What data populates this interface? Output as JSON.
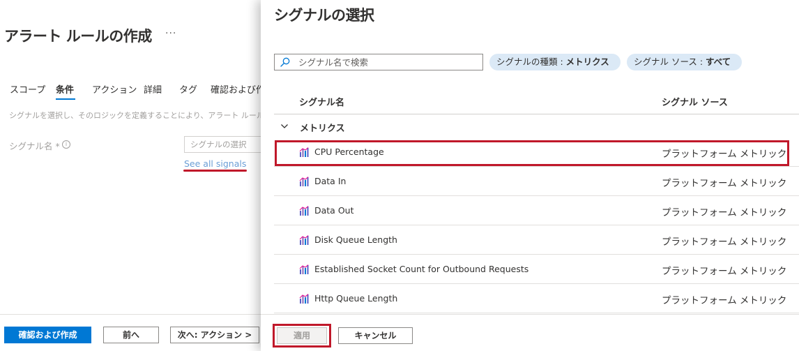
{
  "left": {
    "title": "アラート ルールの作成",
    "ellipsis": "···",
    "tabs": [
      "スコープ",
      "条件",
      "アクション",
      "詳細",
      "タグ",
      "確認および作成"
    ],
    "description": "シグナルを選択し、そのロジックを定義することにより、アラート ルールをトリガーする条件を構成します。",
    "signal_label": "シグナル名",
    "required_mark": "*",
    "info_glyph": "i",
    "signal_placeholder": "シグナルの選択",
    "see_all": "See all signals",
    "footer": {
      "review_create": "確認および作成",
      "previous": "前へ",
      "next": "次へ: アクション >"
    }
  },
  "panel": {
    "title": "シグナルの選択",
    "search_placeholder": "シグナル名で検索",
    "filter_type": {
      "label": "シグナルの種類 : ",
      "value": "メトリクス"
    },
    "filter_source": {
      "label": "シグナル ソース : ",
      "value": "すべて"
    },
    "columns": {
      "name": "シグナル名",
      "source": "シグナル ソース"
    },
    "group": "メトリクス",
    "rows": [
      {
        "name": "CPU Percentage",
        "source": "プラットフォーム メトリック"
      },
      {
        "name": "Data In",
        "source": "プラットフォーム メトリック"
      },
      {
        "name": "Data Out",
        "source": "プラットフォーム メトリック"
      },
      {
        "name": "Disk Queue Length",
        "source": "プラットフォーム メトリック"
      },
      {
        "name": "Established Socket Count for Outbound Requests",
        "source": "プラットフォーム メトリック"
      },
      {
        "name": "Http Queue Length",
        "source": "プラットフォーム メトリック"
      }
    ],
    "apply": "適用",
    "cancel": "キャンセル"
  },
  "icons": {
    "search": "search-icon",
    "chevron": "chevron-down-icon",
    "metric": "metric-chart-icon",
    "info": "info-icon"
  },
  "colors": {
    "accent": "#0078d4",
    "highlight": "#c0182a",
    "pill": "#dbe9f6",
    "link": "#6a9ed6"
  }
}
